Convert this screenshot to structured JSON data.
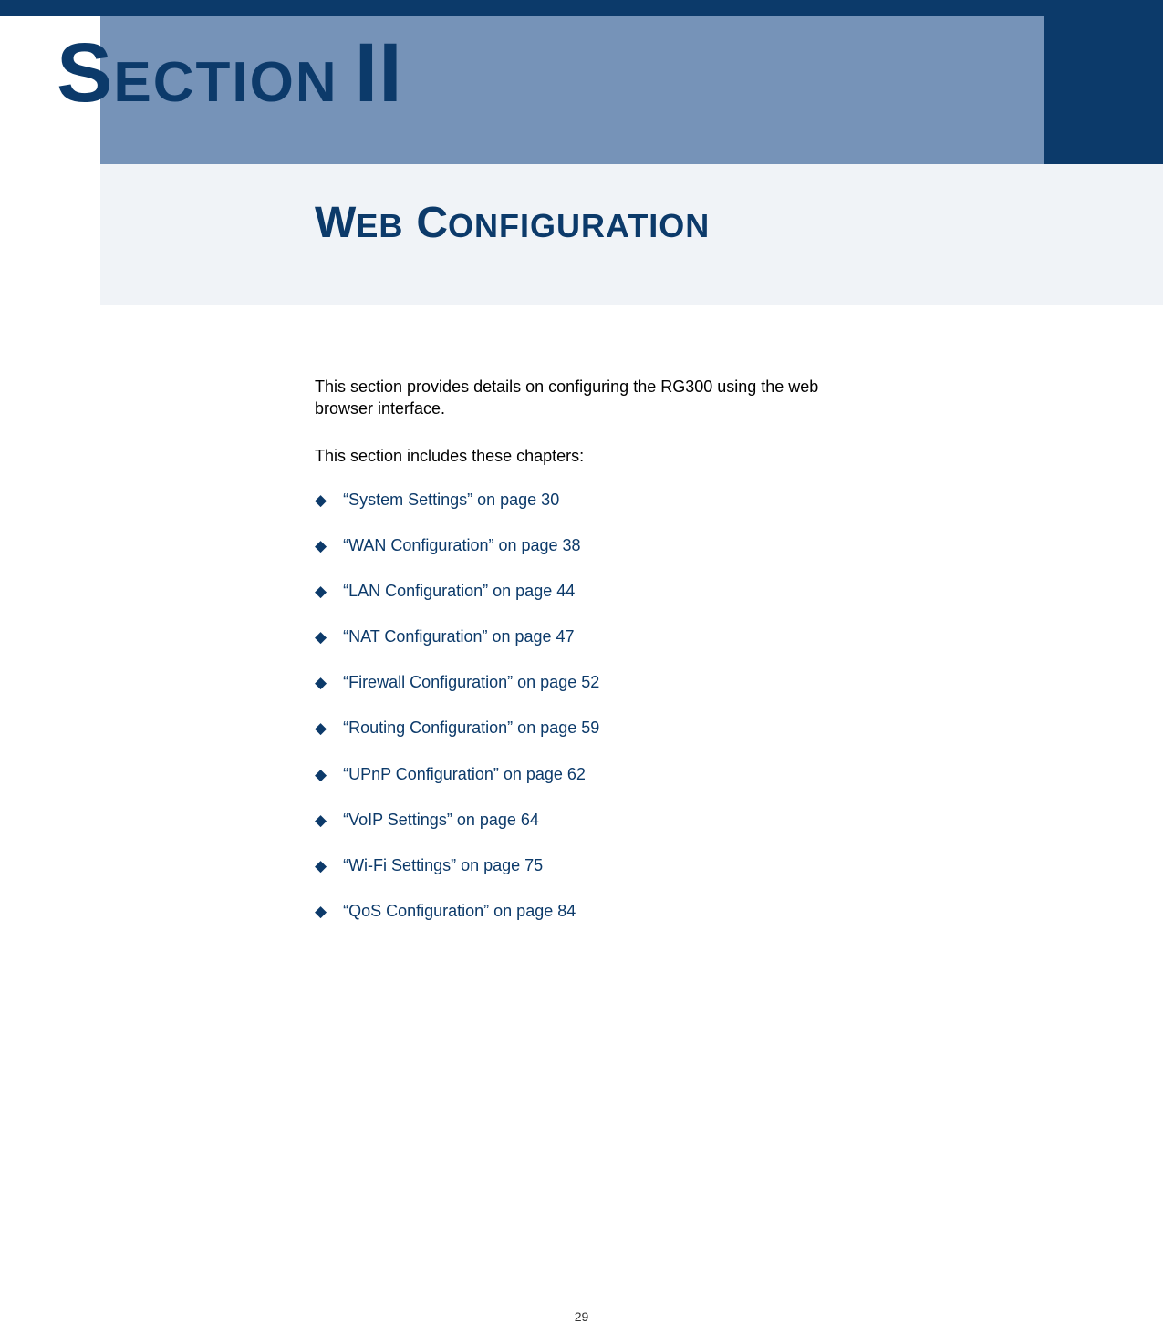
{
  "header": {
    "section_word": "SECTION",
    "section_number": "II"
  },
  "subheader": {
    "word1": "WEB",
    "word2": "CONFIGURATION"
  },
  "body": {
    "intro": "This section provides details on configuring the RG300 using the web browser interface.",
    "includes": "This section includes these chapters:"
  },
  "chapters": [
    {
      "text": "“System Settings” on page 30"
    },
    {
      "text": "“WAN Configuration” on page 38"
    },
    {
      "text": "“LAN Configuration” on page 44"
    },
    {
      "text": "“NAT Configuration” on page 47"
    },
    {
      "text": "“Firewall Configuration” on page 52"
    },
    {
      "text": "“Routing Configuration” on page 59"
    },
    {
      "text": "“UPnP Configuration” on page 62"
    },
    {
      "text": "“VoIP Settings” on page 64"
    },
    {
      "text": "“Wi-Fi Settings” on page 75"
    },
    {
      "text": "“QoS Configuration” on page 84"
    }
  ],
  "footer": {
    "page_label": "–  29  –"
  },
  "bullet_glyph": "◆"
}
